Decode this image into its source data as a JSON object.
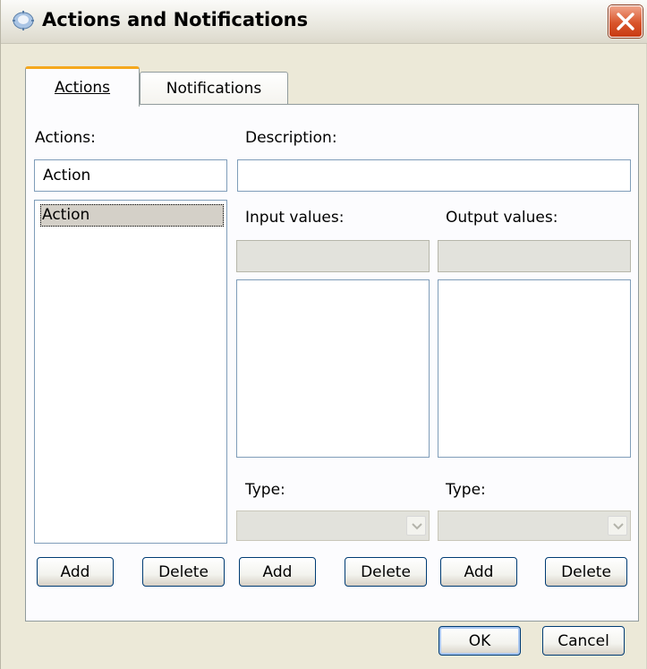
{
  "window": {
    "title": "Actions and Notifications",
    "app_icon": "gear-icon",
    "close_icon": "close-icon"
  },
  "tabs": [
    {
      "label": "Actions",
      "mnemonic_index": 0,
      "selected": true
    },
    {
      "label": "Notifications",
      "mnemonic_index": 1,
      "selected": false
    }
  ],
  "actions_panel": {
    "actions_label": "Actions:",
    "actions_field_value": "Action",
    "actions_list": [
      "Action"
    ],
    "description_label": "Description:",
    "description_value": "",
    "input_values_label": "Input values:",
    "output_values_label": "Output values:",
    "input_value_field": "",
    "output_value_field": "",
    "input_type_label": "Type:",
    "output_type_label": "Type:",
    "input_type_value": "",
    "output_type_value": ""
  },
  "buttons": {
    "add": "Add",
    "delete": "Delete",
    "ok": "OK",
    "cancel": "Cancel"
  },
  "colors": {
    "selected_tab_accent": "#f5a81e",
    "close_button": "#d9552b",
    "dialog_background": "#ece9d8"
  }
}
